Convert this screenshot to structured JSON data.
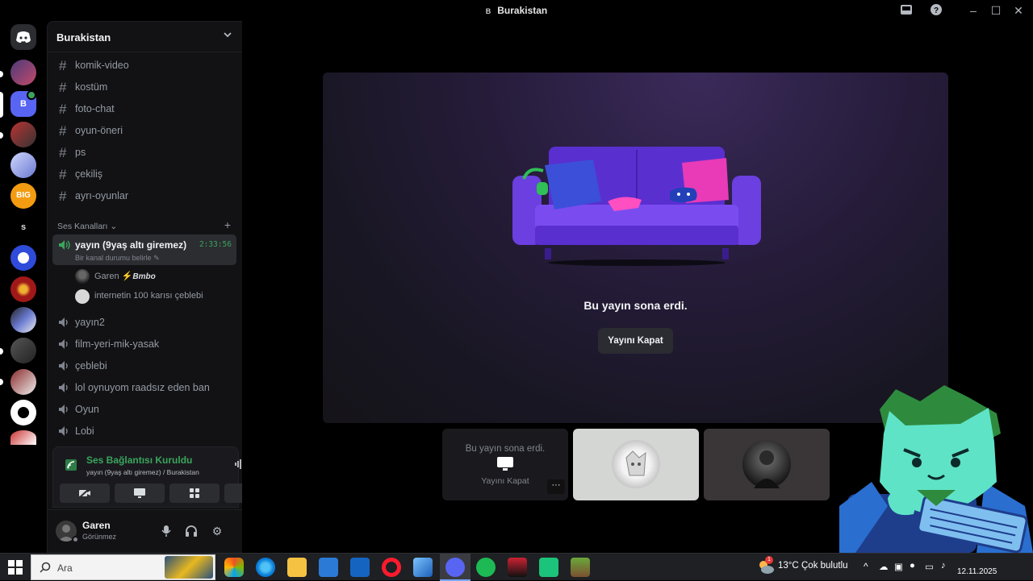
{
  "window": {
    "title": "Burakistan",
    "server_badge": "B"
  },
  "server": {
    "name": "Burakistan"
  },
  "text_channels": [
    "komik-video",
    "kostüm",
    "foto-chat",
    "oyun-öneri",
    "ps",
    "çekiliş",
    "ayrı-oyunlar"
  ],
  "voice_category": {
    "label": "Ses Kanalları"
  },
  "active_voice": {
    "name": "yayın (9yaş altı giremez)",
    "timer": "2:33:56",
    "status": "Bir kanal durumu belirle",
    "members": [
      {
        "name": "Garen",
        "tag": "Bmbo"
      },
      {
        "name": "internetin 100 karısı çeblebi"
      }
    ]
  },
  "voice_channels": [
    "yayın2",
    "film-yeri-mik-yasak",
    "çeblebi",
    "lol oynuyom raadsız eden ban",
    "Oyun",
    "Lobi"
  ],
  "voice_panel": {
    "title": "Ses Bağlantısı Kuruldu",
    "subtitle": "yayın (9yaş altı giremez) / Burakistan"
  },
  "user": {
    "name": "Garen",
    "status": "Görünmez"
  },
  "stream": {
    "ended_message": "Bu yayın sona erdi.",
    "close_button": "Yayını Kapat"
  },
  "tile": {
    "ended_message": "Bu yayın sona erdi.",
    "close_button": "Yayını Kapat",
    "more": "···"
  },
  "taskbar": {
    "search_placeholder": "Ara",
    "weather_temp": "13°C",
    "weather_text": "Çok bulutlu",
    "date": "12.11.2025",
    "weather_badge": "1"
  },
  "colors": {
    "accent_green": "#3ba55d",
    "sofa": "#6b3fe0",
    "stage_bg": "#261c3a"
  }
}
